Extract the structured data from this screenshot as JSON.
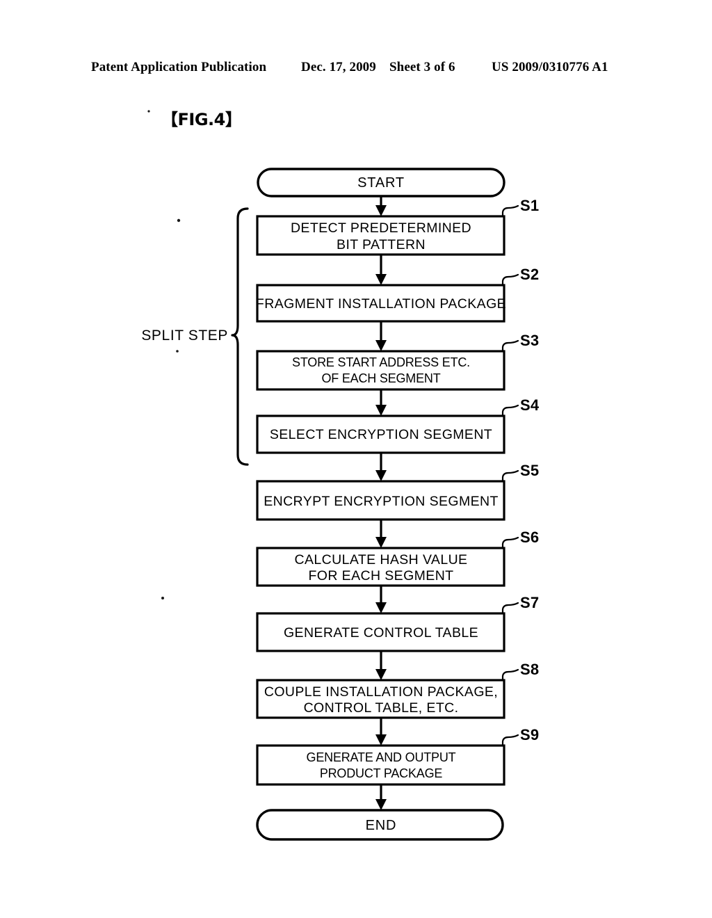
{
  "header": {
    "publication": "Patent Application Publication",
    "date": "Dec. 17, 2009",
    "sheet": "Sheet 3 of 6",
    "patent_number": "US 2009/0310776 A1"
  },
  "figure": {
    "label": "【FIG.4】"
  },
  "flowchart": {
    "group_label": "SPLIT STEP",
    "start_label": "START",
    "end_label": "END",
    "steps": [
      {
        "id": "S1",
        "line1": "DETECT PREDETERMINED",
        "line2": "BIT PATTERN"
      },
      {
        "id": "S2",
        "line1": "FRAGMENT INSTALLATION PACKAGE",
        "line2": ""
      },
      {
        "id": "S3",
        "line1": "STORE START ADDRESS ETC.",
        "line2": "OF EACH SEGMENT"
      },
      {
        "id": "S4",
        "line1": "SELECT ENCRYPTION SEGMENT",
        "line2": ""
      },
      {
        "id": "S5",
        "line1": "ENCRYPT ENCRYPTION SEGMENT",
        "line2": ""
      },
      {
        "id": "S6",
        "line1": "CALCULATE HASH VALUE",
        "line2": "FOR EACH SEGMENT"
      },
      {
        "id": "S7",
        "line1": "GENERATE CONTROL TABLE",
        "line2": ""
      },
      {
        "id": "S8",
        "line1": "COUPLE INSTALLATION PACKAGE,",
        "line2": "CONTROL TABLE, ETC."
      },
      {
        "id": "S9",
        "line1": "GENERATE AND OUTPUT",
        "line2": "PRODUCT PACKAGE"
      }
    ]
  },
  "colors": {
    "ink": "#000000",
    "paper": "#ffffff"
  }
}
